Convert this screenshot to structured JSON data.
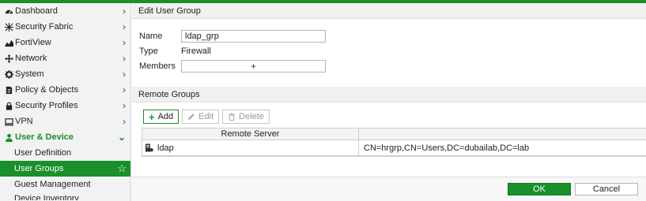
{
  "sidebar": {
    "items": [
      {
        "label": "Dashboard",
        "icon": "dashboard-icon"
      },
      {
        "label": "Security Fabric",
        "icon": "security-fabric-icon"
      },
      {
        "label": "FortiView",
        "icon": "fortiview-icon"
      },
      {
        "label": "Network",
        "icon": "network-icon"
      },
      {
        "label": "System",
        "icon": "gear-icon"
      },
      {
        "label": "Policy & Objects",
        "icon": "policy-icon"
      },
      {
        "label": "Security Profiles",
        "icon": "lock-icon"
      },
      {
        "label": "VPN",
        "icon": "vpn-icon"
      },
      {
        "label": "User & Device",
        "icon": "user-icon"
      }
    ],
    "sub_items": [
      {
        "label": "User Definition"
      },
      {
        "label": "User Groups"
      },
      {
        "label": "Guest Management"
      },
      {
        "label": "Device Inventory"
      }
    ],
    "accent": "#1a8f2a"
  },
  "form": {
    "header": "Edit User Group",
    "name_label": "Name",
    "name_value": "ldap_grp",
    "type_label": "Type",
    "type_value": "Firewall",
    "members_label": "Members",
    "members_add": "+"
  },
  "remote_groups": {
    "header": "Remote Groups",
    "buttons": {
      "add": "Add",
      "edit": "Edit",
      "delete": "Delete"
    },
    "columns": [
      "Remote Server",
      ""
    ],
    "rows": [
      {
        "server": "ldap",
        "group": "CN=hrgrp,CN=Users,DC=dubailab,DC=lab"
      }
    ]
  },
  "footer": {
    "ok": "OK",
    "cancel": "Cancel"
  }
}
